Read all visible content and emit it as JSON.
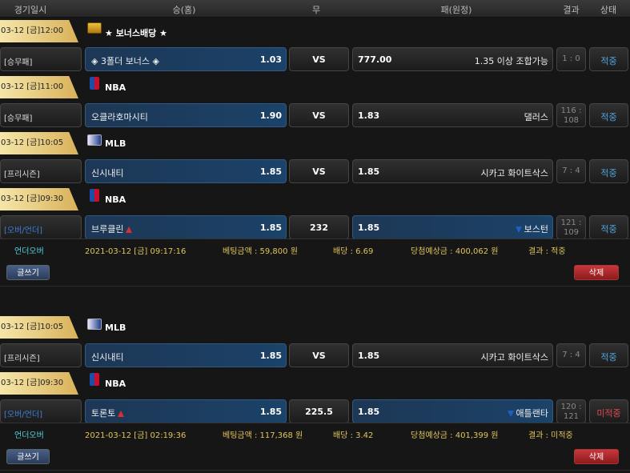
{
  "header": {
    "date": "경기일시",
    "home": "승(홈)",
    "draw": "무",
    "away": "패(원정)",
    "result": "결과",
    "status": "상태"
  },
  "colors": {
    "accent": "#4fa3e0",
    "miss": "#e04848",
    "gold": "#e0c45a"
  },
  "tickets": [
    {
      "rows": [
        {
          "kind": "league",
          "time": "03-12 [금]12:00",
          "icon": "bonus-icon",
          "league": "★ 보너스배당 ★"
        },
        {
          "kind": "game",
          "type": "[승무패]",
          "home": "◈ 3폴더 보너스 ◈",
          "home_odds": "1.03",
          "draw": "VS",
          "away_odds": "777.00",
          "away": "1.35 이상 조합가능",
          "result": "1 : 0",
          "status": "적중"
        },
        {
          "kind": "league",
          "time": "03-12 [금]11:00",
          "icon": "nba-icon",
          "league": "NBA"
        },
        {
          "kind": "game",
          "type": "[승무패]",
          "home": "오클라호마시티",
          "home_odds": "1.90",
          "draw": "VS",
          "away_odds": "1.83",
          "away": "댈러스",
          "result": "116 : 108",
          "status": "적중"
        },
        {
          "kind": "league",
          "time": "03-12 [금]10:05",
          "icon": "mlb-icon",
          "league": "MLB"
        },
        {
          "kind": "game",
          "type": "[프리시즌]",
          "home": "신시내티",
          "home_odds": "1.85",
          "draw": "VS",
          "away_odds": "1.85",
          "away": "시카고 화이트삭스",
          "result": "7 : 4",
          "status": "적중"
        },
        {
          "kind": "league",
          "time": "03-12 [금]09:30",
          "icon": "nba-icon",
          "league": "NBA"
        },
        {
          "kind": "game",
          "type": "[오버/언더]",
          "home": "브루클린",
          "home_odds": "1.85",
          "draw": "232",
          "away_odds": "1.85",
          "away": "보스턴",
          "result": "121 : 109",
          "status": "적중"
        }
      ],
      "summary": {
        "type": "언더오버",
        "date": "2021-03-12 [금] 09:17:16",
        "bet": "베팅금액 : 59,800 원",
        "odds": "배당 : 6.69",
        "win": "당첨예상금 : 400,062 원",
        "result": "결과 : 적중"
      },
      "write_label": "글쓰기",
      "delete_label": "삭제"
    },
    {
      "rows": [
        {
          "kind": "league",
          "time": "03-12 [금]10:05",
          "icon": "mlb-icon",
          "league": "MLB"
        },
        {
          "kind": "game",
          "type": "[프리시즌]",
          "home": "신시내티",
          "home_odds": "1.85",
          "draw": "VS",
          "away_odds": "1.85",
          "away": "시카고 화이트삭스",
          "result": "7 : 4",
          "status": "적중"
        },
        {
          "kind": "league",
          "time": "03-12 [금]09:30",
          "icon": "nba-icon",
          "league": "NBA"
        },
        {
          "kind": "game",
          "type": "[오버/언더]",
          "home": "토론토",
          "home_odds": "1.85",
          "draw": "225.5",
          "away_odds": "1.85",
          "away": "애틀랜타",
          "result": "120 : 121",
          "status": "미적중"
        }
      ],
      "summary": {
        "type": "언더오버",
        "date": "2021-03-12 [금] 02:19:36",
        "bet": "베팅금액 : 117,368 원",
        "odds": "배당 : 3.42",
        "win": "당첨예상금 : 401,399 원",
        "result": "결과 : 미적중"
      },
      "write_label": "글쓰기",
      "delete_label": "삭제"
    }
  ]
}
